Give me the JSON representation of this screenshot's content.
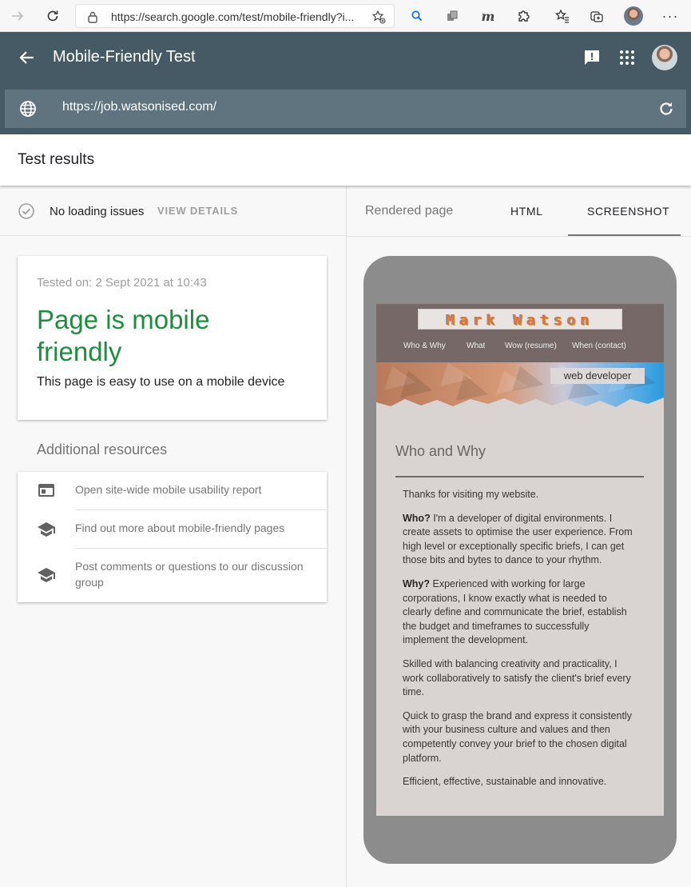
{
  "browser": {
    "url": "https://search.google.com/test/mobile-friendly?i..."
  },
  "app": {
    "title": "Mobile-Friendly Test",
    "url_value": "https://job.watsonised.com/"
  },
  "results": {
    "title": "Test results",
    "status": "No loading issues",
    "view_details": "VIEW DETAILS"
  },
  "card": {
    "tested_on": "Tested on: 2 Sept 2021 at 10:43",
    "verdict": "Page is mobile friendly",
    "description": "This page is easy to use on a mobile device",
    "verdict_color": "#1e8e3e"
  },
  "resources": {
    "title": "Additional resources",
    "items": [
      {
        "label": "Open site-wide mobile usability report",
        "icon": "report-icon"
      },
      {
        "label": "Find out more about mobile-friendly pages",
        "icon": "school-icon"
      },
      {
        "label": "Post comments or questions to our discussion group",
        "icon": "school-icon"
      }
    ]
  },
  "tabs": {
    "rendered": "Rendered page",
    "html": "HTML",
    "screenshot": "SCREENSHOT",
    "active": "SCREENSHOT"
  },
  "site": {
    "logo": "Mark Watson",
    "nav": [
      "Who & Why",
      "What",
      "Wow (resume)",
      "When (contact)"
    ],
    "tagline": "web developer",
    "heading": "Who and Why",
    "p1": "Thanks for visiting my website.",
    "p2_lead": "Who?",
    "p2": " I'm a developer of digital environments. I create assets to optimise the user experience. From high level or exceptionally specific briefs, I can get those bits and bytes to dance to your rhythm.",
    "p3_lead": "Why?",
    "p3": " Experienced with working for large corporations, I know exactly what is needed to clearly define and communicate the brief, establish the budget and timeframes to successfully implement the development.",
    "p4": "Skilled with balancing creativity and practicality, I work collaboratively to satisfy the client's brief every time.",
    "p5": "Quick to grasp the brand and express it consistently with your business culture and values and then competently convey your brief to the chosen digital platform.",
    "p6": "Efficient, effective, sustainable and innovative."
  },
  "colors": {
    "header": "#455a64",
    "url_row": "#5f747f",
    "accent_green": "#1e8e3e"
  }
}
